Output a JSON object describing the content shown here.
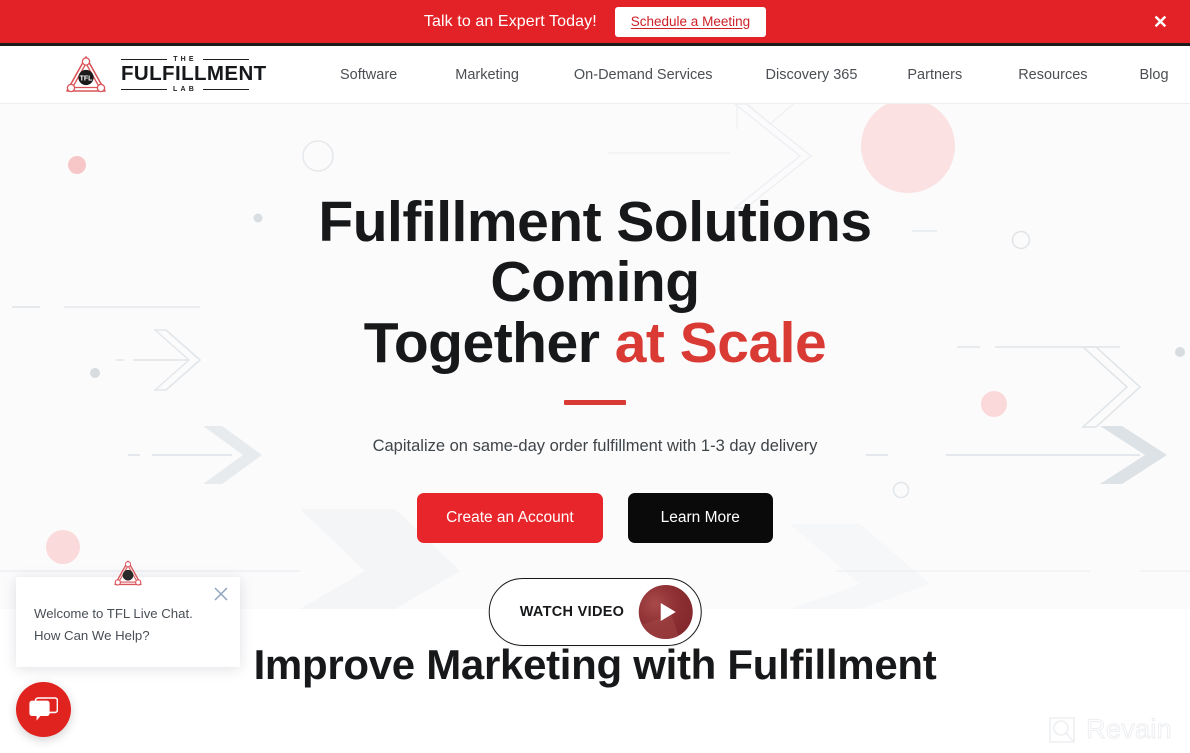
{
  "promo_banner": {
    "text": "Talk to an Expert Today!",
    "cta_label": "Schedule a Meeting",
    "close_icon": "close-icon",
    "background_color": "#E32227"
  },
  "header": {
    "logo": {
      "badge_text": "TFL",
      "line_top": "THE",
      "line_main": "FULFILLMENT",
      "line_bottom": "LAB"
    },
    "nav": [
      {
        "label": "Software"
      },
      {
        "label": "Marketing"
      },
      {
        "label": "On-Demand Services"
      },
      {
        "label": "Discovery 365"
      },
      {
        "label": "Partners"
      },
      {
        "label": "Resources"
      },
      {
        "label": "Blog"
      }
    ]
  },
  "hero": {
    "title_line1": "Fulfillment Solutions Coming",
    "title_line2_plain": "Together ",
    "title_line2_accent": "at Scale",
    "accent_color": "#D93A33",
    "subtitle": "Capitalize on same-day order fulfillment with 1-3 day delivery",
    "primary_button": "Create an Account",
    "secondary_button": "Learn More",
    "watch_video_label": "WATCH VIDEO",
    "play_icon": "play-icon"
  },
  "next_section": {
    "heading": "Improve Marketing with Fulfillment"
  },
  "chat_widget": {
    "message": "Welcome to TFL Live Chat. How Can We Help?",
    "close_icon": "close-icon",
    "avatar_icon": "tfl-logo-icon",
    "fab_icon": "chat-bubbles-icon",
    "fab_color": "#E1231F"
  },
  "watermark": {
    "text": "Revain",
    "icon": "revain-logo-icon"
  }
}
